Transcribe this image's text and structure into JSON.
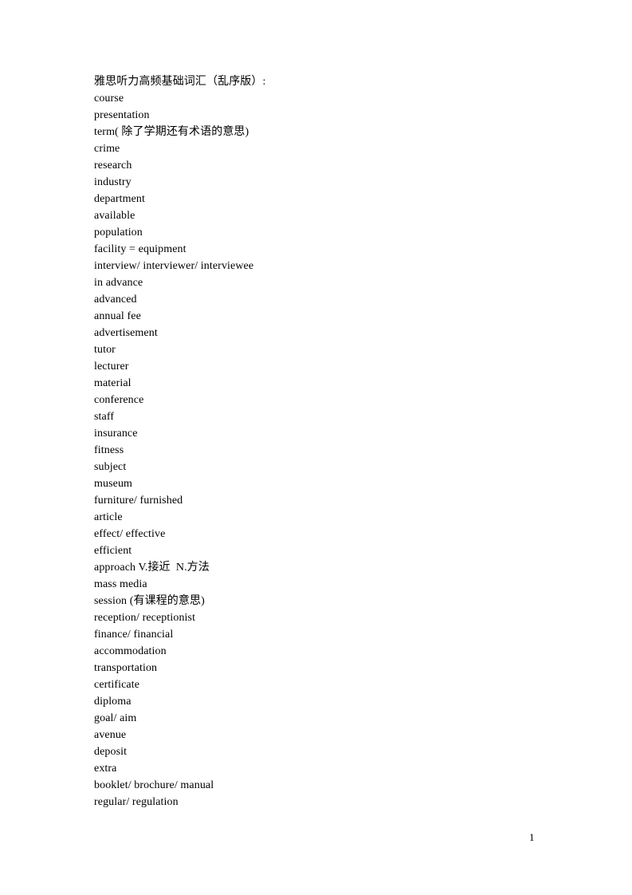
{
  "document": {
    "title": "雅思听力高频基础词汇（乱序版）:",
    "page_number": "1",
    "vocabulary": [
      "course",
      "presentation",
      "term( 除了学期还有术语的意思)",
      "crime",
      "research",
      "industry",
      "department",
      "available",
      "population",
      "facility = equipment",
      "interview/ interviewer/ interviewee",
      "in advance",
      "advanced",
      "annual fee",
      "advertisement",
      "tutor",
      "lecturer",
      "material",
      "conference",
      "staff",
      "insurance",
      "fitness",
      "subject",
      "museum",
      "furniture/ furnished",
      "article",
      "effect/ effective",
      "efficient",
      "approach V.接近  N.方法",
      "mass media",
      "session (有课程的意思)",
      "reception/ receptionist",
      "finance/ financial",
      "accommodation",
      "transportation",
      "certificate",
      "diploma",
      "goal/ aim",
      "avenue",
      "deposit",
      "extra",
      "booklet/ brochure/ manual",
      "regular/ regulation"
    ]
  }
}
